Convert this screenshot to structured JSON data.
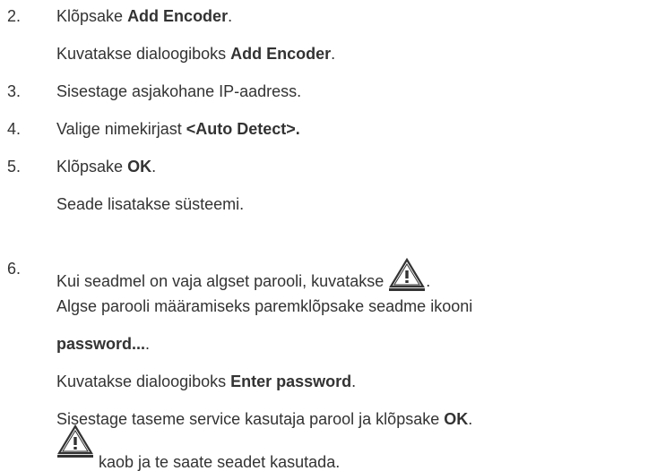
{
  "steps": [
    {
      "number": "2.",
      "lines": [
        {
          "pre": "Klõpsake ",
          "bold": "Add Encoder",
          "post": "."
        },
        {
          "pre": "Kuvatakse dialoogiboks ",
          "bold": "Add Encoder",
          "post": "."
        }
      ]
    },
    {
      "number": "3.",
      "lines": [
        {
          "text": "Sisestage asjakohane IP-aadress."
        }
      ]
    },
    {
      "number": "4.",
      "lines": [
        {
          "pre": "Valige nimekirjast ",
          "bold": "<Auto Detect>."
        }
      ]
    },
    {
      "number": "5.",
      "lines": [
        {
          "pre": "Klõpsake ",
          "bold": "OK",
          "post": "."
        },
        {
          "text": "Seade lisatakse süsteemi."
        }
      ]
    },
    {
      "number": "6.",
      "lines": [
        {
          "pre": "Kui seadmel on vaja algset parooli, kuvatakse ",
          "post": "."
        },
        {
          "text": "Algse parooli määramiseks paremklõpsake seadme ikooni"
        },
        {
          "bold": "password...",
          "post": "."
        },
        {
          "pre": "Kuvatakse dialoogiboks ",
          "bold": "Enter password",
          "post": "."
        },
        {
          "pre": "Sisestage taseme service kasutaja parool ja klõpsake ",
          "bold": "OK",
          "post": "."
        },
        {
          "post": "kaob ja te saate seadet kasutada."
        }
      ]
    }
  ],
  "icon": {
    "name": "warning-triangle-icon",
    "color": "#333333"
  }
}
